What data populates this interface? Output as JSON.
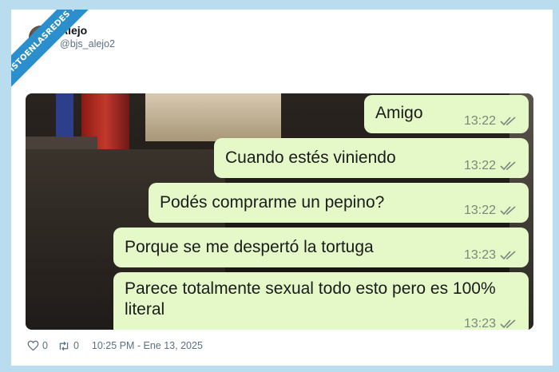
{
  "watermark": "VISTOENLASREDES .com",
  "tweet": {
    "display_name": "Alejo",
    "handle": "@bjs_alejo2",
    "likes": "0",
    "retweets": "0",
    "timestamp": "10:25 PM - Ene 13, 2025"
  },
  "chat": {
    "bubble_color": "#e4f8c8",
    "messages": [
      {
        "text": "Amigo",
        "time": "13:22"
      },
      {
        "text": "Cuando estés viniendo",
        "time": "13:22"
      },
      {
        "text": "Podés comprarme un pepino?",
        "time": "13:22"
      },
      {
        "text": "Porque se me despertó la tortuga",
        "time": "13:23"
      },
      {
        "text": "Parece totalmente sexual todo esto pero es 100% literal",
        "time": "13:23"
      }
    ]
  },
  "icons": [
    "heart-icon",
    "retweet-icon",
    "double-check-icon"
  ]
}
